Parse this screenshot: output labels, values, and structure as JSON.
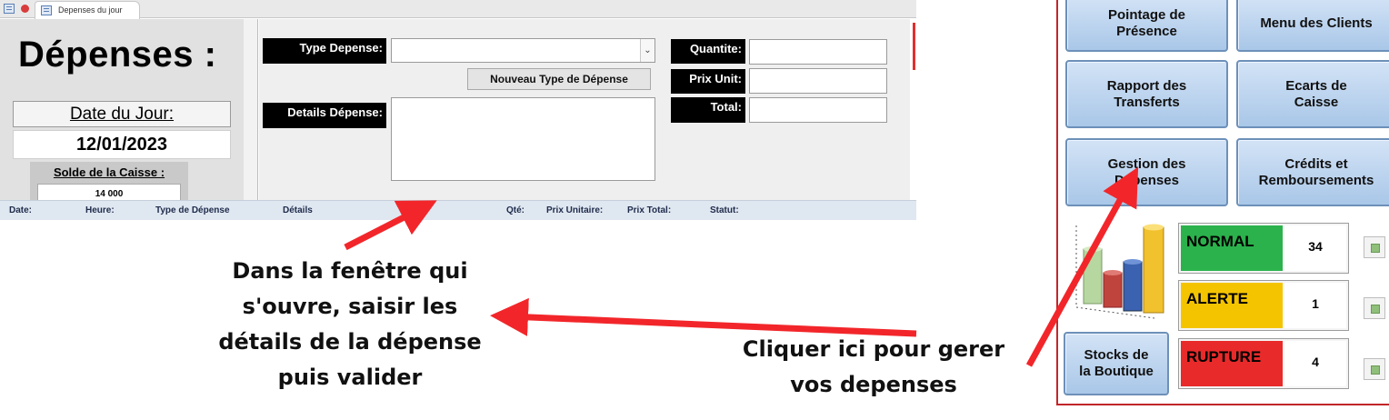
{
  "tab": {
    "label": "Depenses du jour"
  },
  "form": {
    "title": "Dépenses :",
    "date_label": "Date du Jour:",
    "date_value": "12/01/2023",
    "solde_label": "Solde de la Caisse :",
    "solde_value": "14 000",
    "type_depense_label": "Type Depense:",
    "type_depense_value": "",
    "nouveau_type_button": "Nouveau Type de Dépense",
    "details_label": "Details Dépense:",
    "details_value": "",
    "quantite_label": "Quantite:",
    "prix_unit_label": "Prix Unit:",
    "total_label": "Total:"
  },
  "table_headers": [
    "Date:",
    "Heure:",
    "Type de Dépense",
    "Détails",
    "Qté:",
    "Prix Unitaire:",
    "Prix Total:",
    "Statut:"
  ],
  "menu": {
    "pointage": "Pointage de\nPrésence",
    "menu_clients": "Menu des Clients",
    "rapport_transferts": "Rapport des\nTransferts",
    "ecarts_caisse": "Ecarts de\nCaisse",
    "gestion_depenses": "Gestion des\nDépenses",
    "credits": "Crédits et\nRemboursements",
    "stocks_boutique": "Stocks de\nla Boutique"
  },
  "stock_status": [
    {
      "label": "NORMAL",
      "count": "34",
      "color": "#2bb24c"
    },
    {
      "label": "ALERTE",
      "count": "1",
      "color": "#f5c400"
    },
    {
      "label": "RUPTURE",
      "count": "4",
      "color": "#e82a2a"
    }
  ],
  "annotations": {
    "left": [
      "Dans la fenêtre qui",
      "s'ouvre, saisir les",
      "détails de la dépense",
      "puis valider"
    ],
    "right": [
      "Cliquer ici pour gerer",
      "vos depenses"
    ]
  },
  "colors": {
    "arrow": "#f2262a",
    "menu_border": "#c2262a",
    "button": "#bcd4ef"
  },
  "icons": [
    "form-icon",
    "record-icon",
    "dropdown-icon",
    "bar-chart-icon",
    "action-icon"
  ]
}
